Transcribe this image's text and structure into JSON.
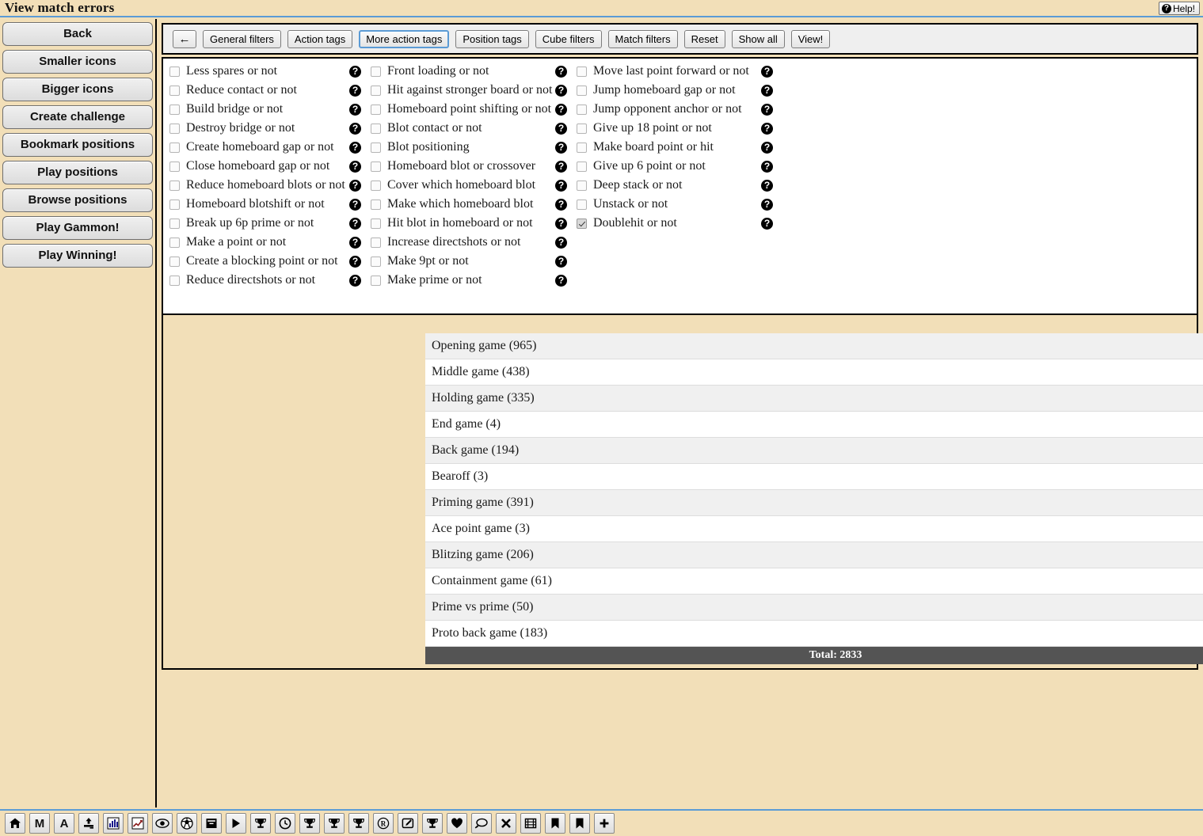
{
  "titlebar": {
    "title": "View match errors",
    "help_label": "Help!",
    "help_icon": "question-circle-icon"
  },
  "sidebar": {
    "buttons": [
      {
        "label": "Back"
      },
      {
        "label": "Smaller icons"
      },
      {
        "label": "Bigger icons"
      },
      {
        "label": "Create challenge"
      },
      {
        "label": "Bookmark positions"
      },
      {
        "label": "Play positions"
      },
      {
        "label": "Browse positions"
      },
      {
        "label": "Play Gammon!"
      },
      {
        "label": "Play Winning!"
      }
    ]
  },
  "filter_toolbar": {
    "back_arrow": "←",
    "buttons": [
      {
        "label": "General filters",
        "focused": false
      },
      {
        "label": "Action tags",
        "focused": false
      },
      {
        "label": "More action tags",
        "focused": true
      },
      {
        "label": "Position tags",
        "focused": false
      },
      {
        "label": "Cube filters",
        "focused": false
      },
      {
        "label": "Match filters",
        "focused": false
      },
      {
        "label": "Reset",
        "focused": false
      },
      {
        "label": "Show all",
        "focused": false
      },
      {
        "label": "View!",
        "focused": false
      }
    ]
  },
  "tag_panel": {
    "help_icon": "question-circle-icon",
    "columns": [
      {
        "items": [
          {
            "label": "Less spares or not",
            "checked": false
          },
          {
            "label": "Reduce contact or not",
            "checked": false
          },
          {
            "label": "Build bridge or not",
            "checked": false
          },
          {
            "label": "Destroy bridge or not",
            "checked": false
          },
          {
            "label": "Create homeboard gap or not",
            "checked": false
          },
          {
            "label": "Close homeboard gap or not",
            "checked": false
          },
          {
            "label": "Reduce homeboard blots or not",
            "checked": false
          },
          {
            "label": "Homeboard blotshift or not",
            "checked": false
          },
          {
            "label": "Break up 6p prime or not",
            "checked": false
          },
          {
            "label": "Make a point or not",
            "checked": false
          },
          {
            "label": "Create a blocking point or not",
            "checked": false
          },
          {
            "label": "Reduce directshots or not",
            "checked": false
          }
        ]
      },
      {
        "items": [
          {
            "label": "Front loading or not",
            "checked": false
          },
          {
            "label": "Hit against stronger board or not",
            "checked": false
          },
          {
            "label": "Homeboard point shifting or not",
            "checked": false
          },
          {
            "label": "Blot contact or not",
            "checked": false
          },
          {
            "label": "Blot positioning",
            "checked": false
          },
          {
            "label": "Homeboard blot or crossover",
            "checked": false
          },
          {
            "label": "Cover which homeboard blot",
            "checked": false
          },
          {
            "label": "Make which homeboard blot",
            "checked": false
          },
          {
            "label": "Hit blot in homeboard or not",
            "checked": false
          },
          {
            "label": "Increase directshots or not",
            "checked": false
          },
          {
            "label": "Make 9pt or not",
            "checked": false
          },
          {
            "label": "Make prime or not",
            "checked": false
          }
        ]
      },
      {
        "items": [
          {
            "label": "Move last point forward or not",
            "checked": false
          },
          {
            "label": "Jump homeboard gap or not",
            "checked": false
          },
          {
            "label": "Jump opponent anchor or not",
            "checked": false
          },
          {
            "label": "Give up 18 point or not",
            "checked": false
          },
          {
            "label": "Make board point or hit",
            "checked": false
          },
          {
            "label": "Give up 6 point or not",
            "checked": false
          },
          {
            "label": "Deep stack or not",
            "checked": false
          },
          {
            "label": "Unstack or not",
            "checked": false
          },
          {
            "label": "Doublehit or not",
            "checked": true
          }
        ]
      }
    ]
  },
  "game_list": {
    "rows": [
      {
        "label": "Opening game (965)"
      },
      {
        "label": "Middle game (438)"
      },
      {
        "label": "Holding game (335)"
      },
      {
        "label": "End game (4)"
      },
      {
        "label": "Back game (194)"
      },
      {
        "label": "Bearoff (3)"
      },
      {
        "label": "Priming game (391)"
      },
      {
        "label": "Ace point game (3)"
      },
      {
        "label": "Blitzing game (206)"
      },
      {
        "label": "Containment game (61)"
      },
      {
        "label": "Prime vs prime (50)"
      },
      {
        "label": "Proto back game (183)"
      }
    ],
    "total_label": "Total: 2833"
  },
  "bottom_toolbar": {
    "buttons": [
      {
        "icon": "home-icon",
        "glyph": ""
      },
      {
        "icon": "letter-m-icon",
        "glyph": "M"
      },
      {
        "icon": "letter-a-icon",
        "glyph": "A"
      },
      {
        "icon": "upload-icon",
        "glyph": ""
      },
      {
        "icon": "bar-chart-icon",
        "glyph": ""
      },
      {
        "icon": "line-chart-icon",
        "glyph": ""
      },
      {
        "icon": "eye-icon",
        "glyph": ""
      },
      {
        "icon": "soccer-ball-icon",
        "glyph": ""
      },
      {
        "icon": "archive-box-icon",
        "glyph": ""
      },
      {
        "icon": "play-icon",
        "glyph": ""
      },
      {
        "icon": "trophy-icon",
        "glyph": ""
      },
      {
        "icon": "clock-icon",
        "glyph": ""
      },
      {
        "icon": "trophy-icon",
        "glyph": ""
      },
      {
        "icon": "trophy-icon",
        "glyph": ""
      },
      {
        "icon": "trophy-icon",
        "glyph": ""
      },
      {
        "icon": "registered-icon",
        "glyph": ""
      },
      {
        "icon": "edit-pencil-icon",
        "glyph": ""
      },
      {
        "icon": "trophy-icon",
        "glyph": ""
      },
      {
        "icon": "heart-icon",
        "glyph": ""
      },
      {
        "icon": "comment-icon",
        "glyph": ""
      },
      {
        "icon": "close-x-icon",
        "glyph": ""
      },
      {
        "icon": "film-strip-icon",
        "glyph": ""
      },
      {
        "icon": "bookmark-icon",
        "glyph": ""
      },
      {
        "icon": "bookmark-icon",
        "glyph": ""
      },
      {
        "icon": "plus-icon",
        "glyph": ""
      }
    ]
  },
  "colors": {
    "page_background": "#f2dfb8",
    "accent_blue": "#5b9bd5",
    "panel_white": "#ffffff",
    "row_alt": "#f0f0f0",
    "total_bar": "#545454"
  }
}
